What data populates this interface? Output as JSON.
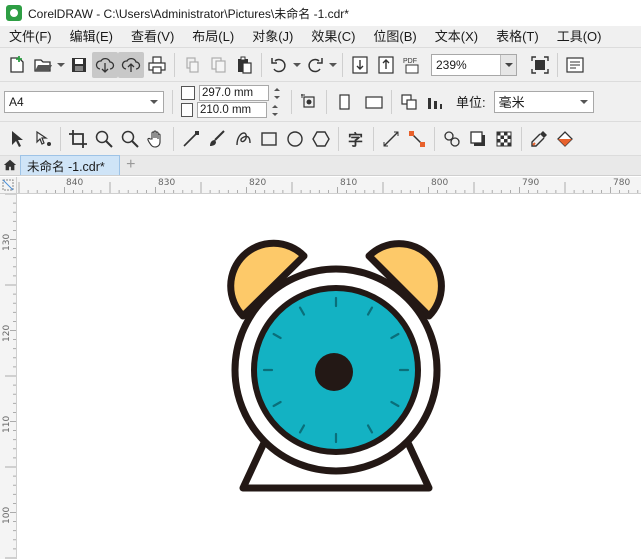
{
  "window": {
    "title": "CorelDRAW - C:\\Users\\Administrator\\Pictures\\未命名 -1.cdr*"
  },
  "menu": {
    "items": [
      "文件(F)",
      "编辑(E)",
      "查看(V)",
      "布局(L)",
      "对象(J)",
      "效果(C)",
      "位图(B)",
      "文本(X)",
      "表格(T)",
      "工具(O)"
    ]
  },
  "standard_toolbar": {
    "zoom_value": "239%"
  },
  "property_bar": {
    "page_size": "A4",
    "width_value": "297.0 mm",
    "height_value": "210.0 mm",
    "unit_label": "单位:",
    "unit_value": "毫米"
  },
  "tabs": {
    "document_tab": "未命名 -1.cdr*",
    "add_tab": "+"
  },
  "rulers": {
    "horizontal": [
      "840",
      "830",
      "820",
      "810",
      "800",
      "790",
      "780"
    ],
    "vertical": [
      "130",
      "120",
      "110",
      "100"
    ]
  },
  "colors": {
    "clock_face": "#13b2c3",
    "bells": "#fdc969",
    "outline": "#231815",
    "background_white": "#ffffff"
  }
}
